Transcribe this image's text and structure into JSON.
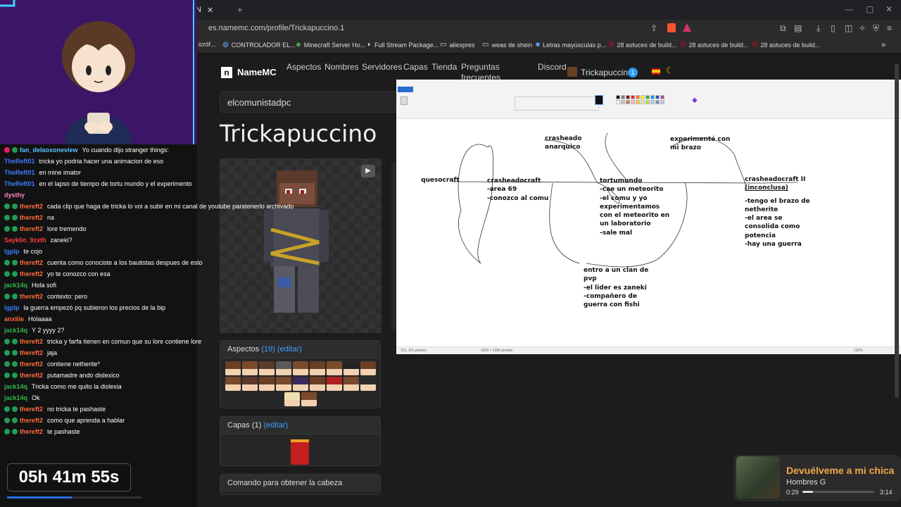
{
  "browser": {
    "tab_title": "N",
    "url": "es.namemc.com/profile/Trickapuccino.1",
    "bookmarks": [
      {
        "icon": "folder-icon",
        "label": "icróf..."
      },
      {
        "icon": "globe-icon",
        "label": "CONTROLADOR EL..."
      },
      {
        "icon": "minecraft-icon",
        "label": "Minecraft Server Ho..."
      },
      {
        "icon": "stream-icon",
        "label": "Full Stream Package..."
      },
      {
        "icon": "folder-icon",
        "label": "aliexpres"
      },
      {
        "icon": "folder-icon",
        "label": "weas de shein"
      },
      {
        "icon": "bookmark-icon",
        "label": "Letras mayúsculas p..."
      },
      {
        "icon": "pinterest-icon",
        "label": "28 astuces de build..."
      },
      {
        "icon": "pinterest-icon",
        "label": "28 astuces de build..."
      },
      {
        "icon": "pinterest-icon",
        "label": "28 astuces de build..."
      }
    ]
  },
  "namemc": {
    "brand": "NameMC",
    "nav": [
      "Aspectos",
      "Nombres",
      "Servidores",
      "Capas",
      "Tienda",
      "Preguntas frecuentes",
      "Discord"
    ],
    "user": "Trickapuccino",
    "notif_count": "1",
    "search_value": "elcomunistadpc",
    "profile_name": "Trickapuccino",
    "skins_title": "Aspectos",
    "skins_count": "(19)",
    "edit_label": "(editar)",
    "capes_title": "Capas",
    "capes_count": "(1)",
    "head_cmd": "Comando para obtener la cabeza"
  },
  "paint": {
    "status_left": "151, 261 píxeles",
    "status_mid": "1920 × 1080 píxeles",
    "status_zoom": "100%",
    "notes": {
      "quesocraft": "quesocraft",
      "crasheado": [
        "crasheado",
        "anarquico"
      ],
      "experimente": [
        "experimenté con",
        "mi brazo"
      ],
      "crasheadocraft": [
        "crasheadocraft",
        "-area 69",
        "-conozco al comu"
      ],
      "tortumundo": [
        "tortumundo",
        "-cae un meteorito",
        "-el comu y yo",
        "experimentamos",
        "con el meteorito en",
        "un laboratorio",
        "-sale mal"
      ],
      "crasheadocraft2": [
        "crasheadocraft II",
        "(inconclusa)",
        "",
        "-tengo el brazo de",
        "netherite",
        "-el area se",
        "consolida como",
        "potencia",
        "-hay una guerra"
      ],
      "clan": [
        "entro a un clan de",
        "pvp",
        "-el lider es zaneki",
        "-compañero de",
        "guerra con fishi"
      ]
    }
  },
  "chat": [
    {
      "user": "fan_delaosoneview",
      "color": "#5bc0ff",
      "text": "Yo cuando dijo stranger things:",
      "badges": 2
    },
    {
      "user": "TheReft01",
      "color": "#3a7bff",
      "text": "tricka yo podria hacer una animacion de eso",
      "badges": 0
    },
    {
      "user": "TheReft01",
      "color": "#3a7bff",
      "text": "en mine imator",
      "badges": 0
    },
    {
      "user": "TheReft01",
      "color": "#3a7bff",
      "text": "en el lapso de tiempo de tortu mundo y el experimento",
      "badges": 0
    },
    {
      "user": "dysthy",
      "color": "#ff80c0",
      "text": "",
      "badges": 0
    },
    {
      "user": "thereft2",
      "color": "#ff6a3d",
      "text": "cada clip que haga de tricka lo voi a subir en mi canal de youtube paratenerlo archivado",
      "badges": 2
    },
    {
      "user": "thereft2",
      "color": "#ff6a3d",
      "text": "na",
      "badges": 2
    },
    {
      "user": "thereft2",
      "color": "#ff6a3d",
      "text": "lore tremendo",
      "badges": 2
    },
    {
      "user": "Sayk0o_9zxth",
      "color": "#ff3d3d",
      "text": "zaneki?",
      "badges": 0
    },
    {
      "user": "lgplp",
      "color": "#3a7bff",
      "text": "te cojo",
      "badges": 0
    },
    {
      "user": "thereft2",
      "color": "#ff6a3d",
      "text": "cuenta como conociste a los bautistas despues de esto",
      "badges": 2
    },
    {
      "user": "thereft2",
      "color": "#ff6a3d",
      "text": "yo te conozco con esa",
      "badges": 2
    },
    {
      "user": "jack14q",
      "color": "#2fb84a",
      "text": "Hola sofi",
      "badges": 0
    },
    {
      "user": "thereft2",
      "color": "#ff6a3d",
      "text": "contexto: pero",
      "badges": 2
    },
    {
      "user": "lgplp",
      "color": "#3a7bff",
      "text": "la guerra empezó pq subieron los precios de la bip",
      "badges": 0
    },
    {
      "user": "anxliie",
      "color": "#ff6a3d",
      "text": "Holaaaa",
      "badges": 0
    },
    {
      "user": "jack14q",
      "color": "#2fb84a",
      "text": "Y 2 yyyy 2?",
      "badges": 0
    },
    {
      "user": "thereft2",
      "color": "#ff6a3d",
      "text": "tricka y farfa tienen en comun que su lore contiene lore",
      "badges": 2
    },
    {
      "user": "thereft2",
      "color": "#ff6a3d",
      "text": "jaja",
      "badges": 2
    },
    {
      "user": "thereft2",
      "color": "#ff6a3d",
      "text": "contiene netherite*",
      "badges": 2
    },
    {
      "user": "thereft2",
      "color": "#ff6a3d",
      "text": "putamadre ando dislexico",
      "badges": 2
    },
    {
      "user": "jack14q",
      "color": "#2fb84a",
      "text": "Tricka como me quito la dislexia",
      "badges": 0
    },
    {
      "user": "jack14q",
      "color": "#2fb84a",
      "text": "Ok",
      "badges": 0
    },
    {
      "user": "thereft2",
      "color": "#ff6a3d",
      "text": "no tricka te pashaste",
      "badges": 2
    },
    {
      "user": "thereft2",
      "color": "#ff6a3d",
      "text": "como que aprenda a hablar",
      "badges": 2
    },
    {
      "user": "thereft2",
      "color": "#ff6a3d",
      "text": "te pashaste",
      "badges": 2
    }
  ],
  "timer": {
    "text": "05h 41m 55s",
    "progress": 0.48
  },
  "music": {
    "song": "Devuélveme a mi chica",
    "artist": "Hombres G",
    "elapsed": "0:29",
    "total": "3:14",
    "progress": 0.15
  }
}
